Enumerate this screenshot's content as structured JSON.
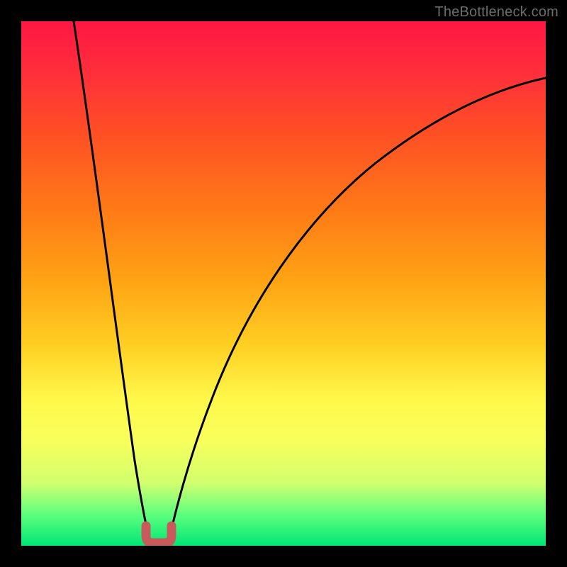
{
  "watermark": "TheBottleneck.com",
  "chart_data": {
    "type": "line",
    "title": "",
    "xlabel": "",
    "ylabel": "",
    "xlim": [
      0,
      100
    ],
    "ylim": [
      0,
      100
    ],
    "grid": false,
    "legend": false,
    "series": [
      {
        "name": "left-branch",
        "x": [
          10,
          12,
          14,
          16,
          18,
          20,
          22,
          23,
          24
        ],
        "y": [
          100,
          83,
          66,
          50,
          34,
          18,
          6,
          2,
          0
        ]
      },
      {
        "name": "right-branch",
        "x": [
          27,
          28,
          30,
          33,
          37,
          42,
          48,
          55,
          63,
          72,
          82,
          92,
          100
        ],
        "y": [
          0,
          3,
          10,
          21,
          34,
          46,
          56,
          65,
          72,
          78,
          83,
          87,
          89
        ]
      },
      {
        "name": "minimum-marker",
        "x": [
          23,
          23.5,
          24.5,
          26,
          27.5,
          28,
          28
        ],
        "y": [
          3.5,
          1,
          0,
          0,
          0,
          1,
          3.5
        ]
      }
    ],
    "colors": {
      "curve": "#000000",
      "marker": "#c75a5a",
      "gradient_top": "#ff1744",
      "gradient_bottom": "#00e676"
    }
  }
}
